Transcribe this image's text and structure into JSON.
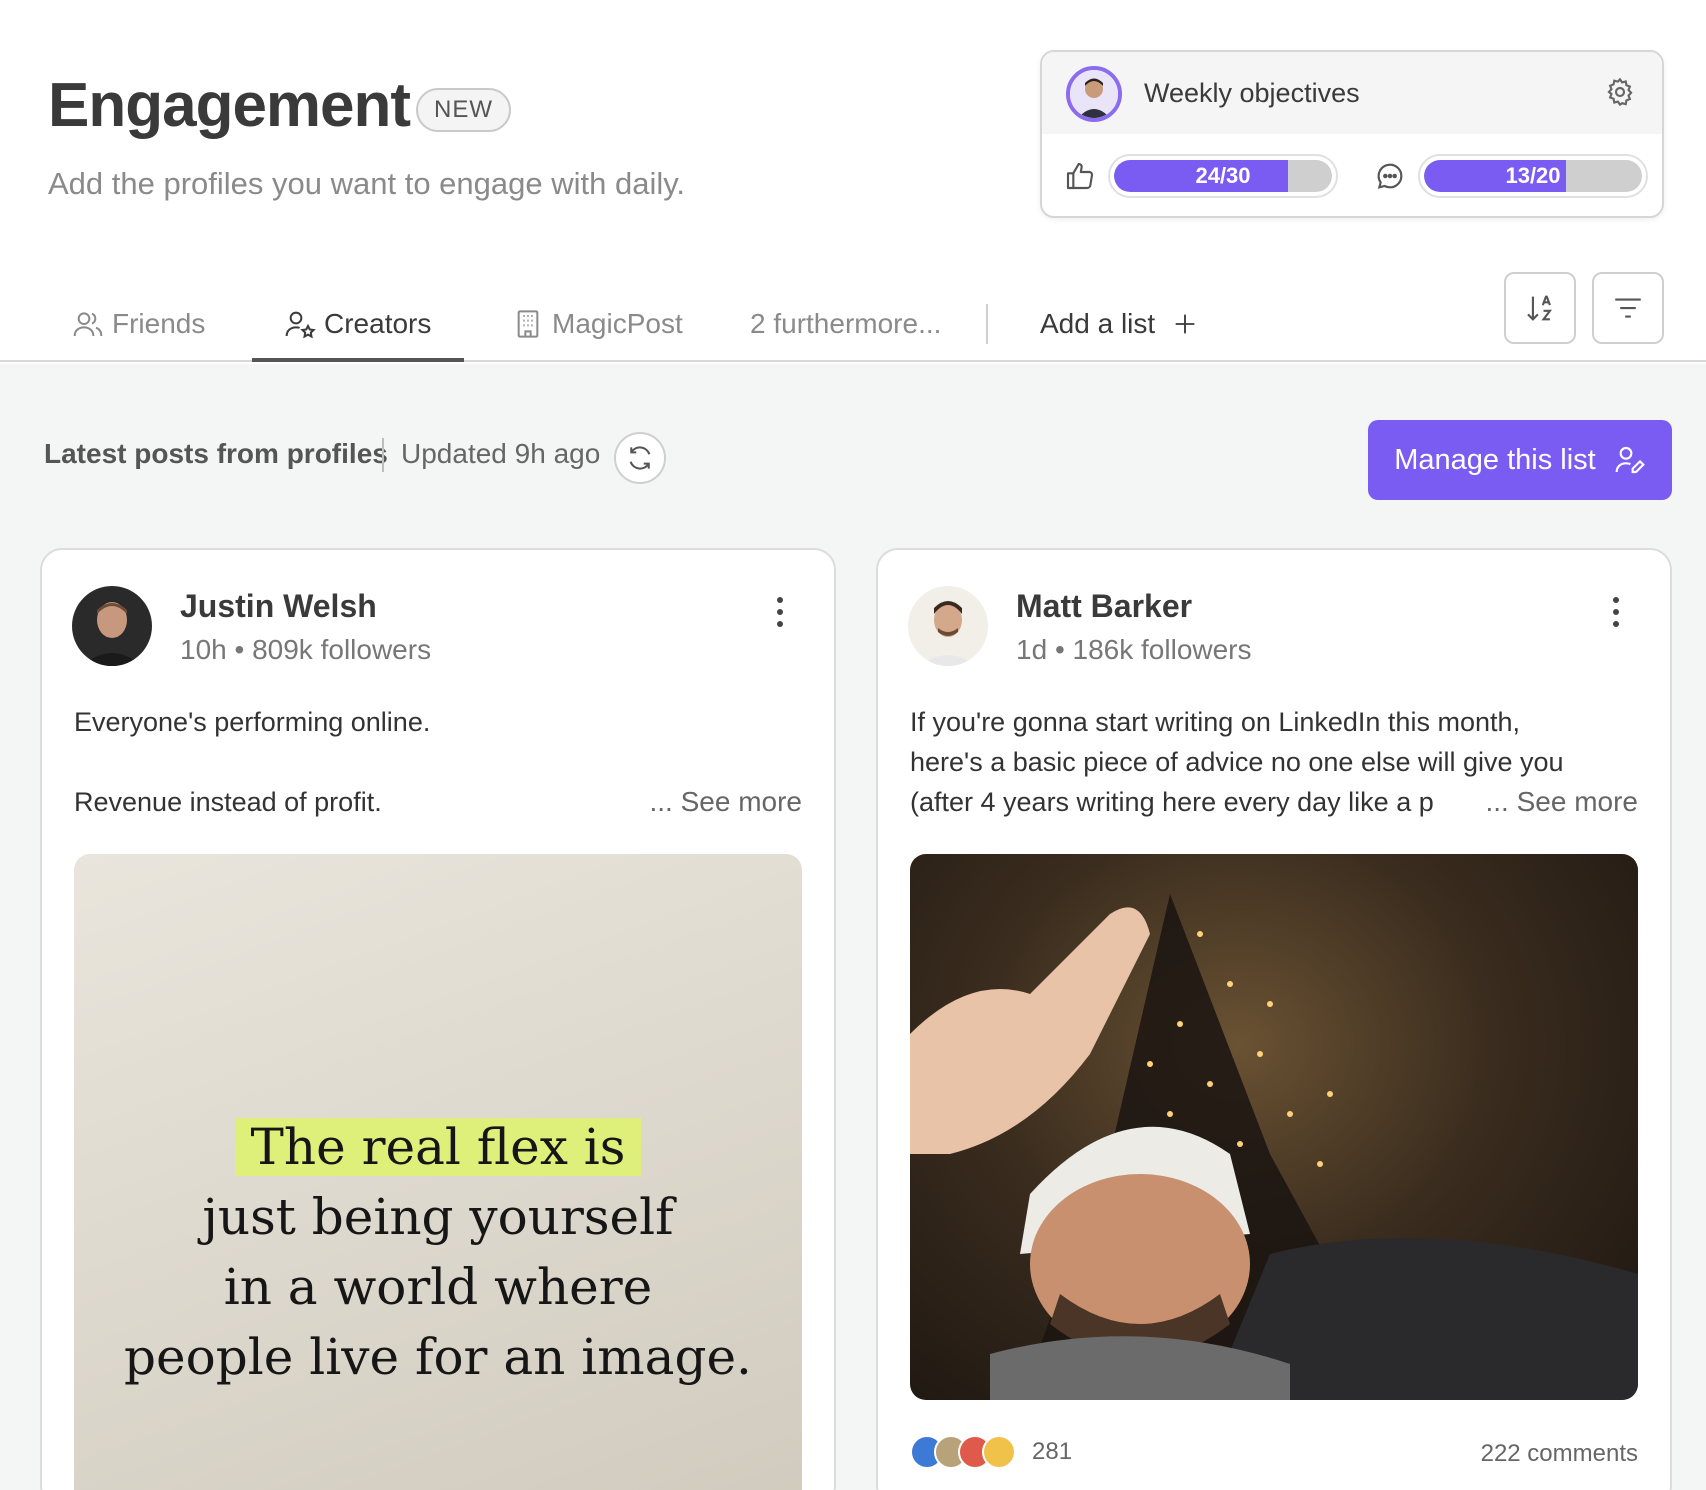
{
  "header": {
    "title": "Engagement",
    "badge": "NEW",
    "subtitle": "Add the profiles you want to engage with daily."
  },
  "objectives": {
    "title": "Weekly objectives",
    "likes": {
      "label": "24/30",
      "value": 24,
      "target": 30
    },
    "comments": {
      "label": "13/20",
      "value": 13,
      "target": 20
    },
    "icons": [
      "avatar",
      "gear-icon",
      "thumbs-up-icon",
      "comment-icon"
    ]
  },
  "tabs": [
    {
      "label": "Friends",
      "icon": "users-icon",
      "active": false
    },
    {
      "label": "Creators",
      "icon": "user-star-icon",
      "active": true
    },
    {
      "label": "MagicPost",
      "icon": "building-icon",
      "active": false
    },
    {
      "label": "2 furthermore...",
      "active": false
    }
  ],
  "add_list": "Add a list",
  "content": {
    "latest_label": "Latest posts from profiles",
    "updated_label": "Updated 9h ago",
    "manage_button": "Manage this list"
  },
  "posts": [
    {
      "author": "Justin Welsh",
      "time": "10h",
      "followers": "809k followers",
      "lines": [
        "Everyone's performing online.",
        "",
        "Revenue instead of profit."
      ],
      "see_more": "... See more",
      "image_quote": [
        "The real flex is",
        "just being yourself",
        "in a world where",
        "people live for an image."
      ]
    },
    {
      "author": "Matt Barker",
      "time": "1d",
      "followers": "186k followers",
      "lines": [
        "If you're gonna start writing on LinkedIn this month,",
        "here's a basic piece of advice no one else will give you",
        "(after 4 years writing here every day like a p"
      ],
      "see_more": "... See more",
      "reactions": "281",
      "comments": "222 comments"
    }
  ],
  "colors": {
    "accent": "#7b5cf2",
    "quote_highlight": "#dff07a"
  }
}
